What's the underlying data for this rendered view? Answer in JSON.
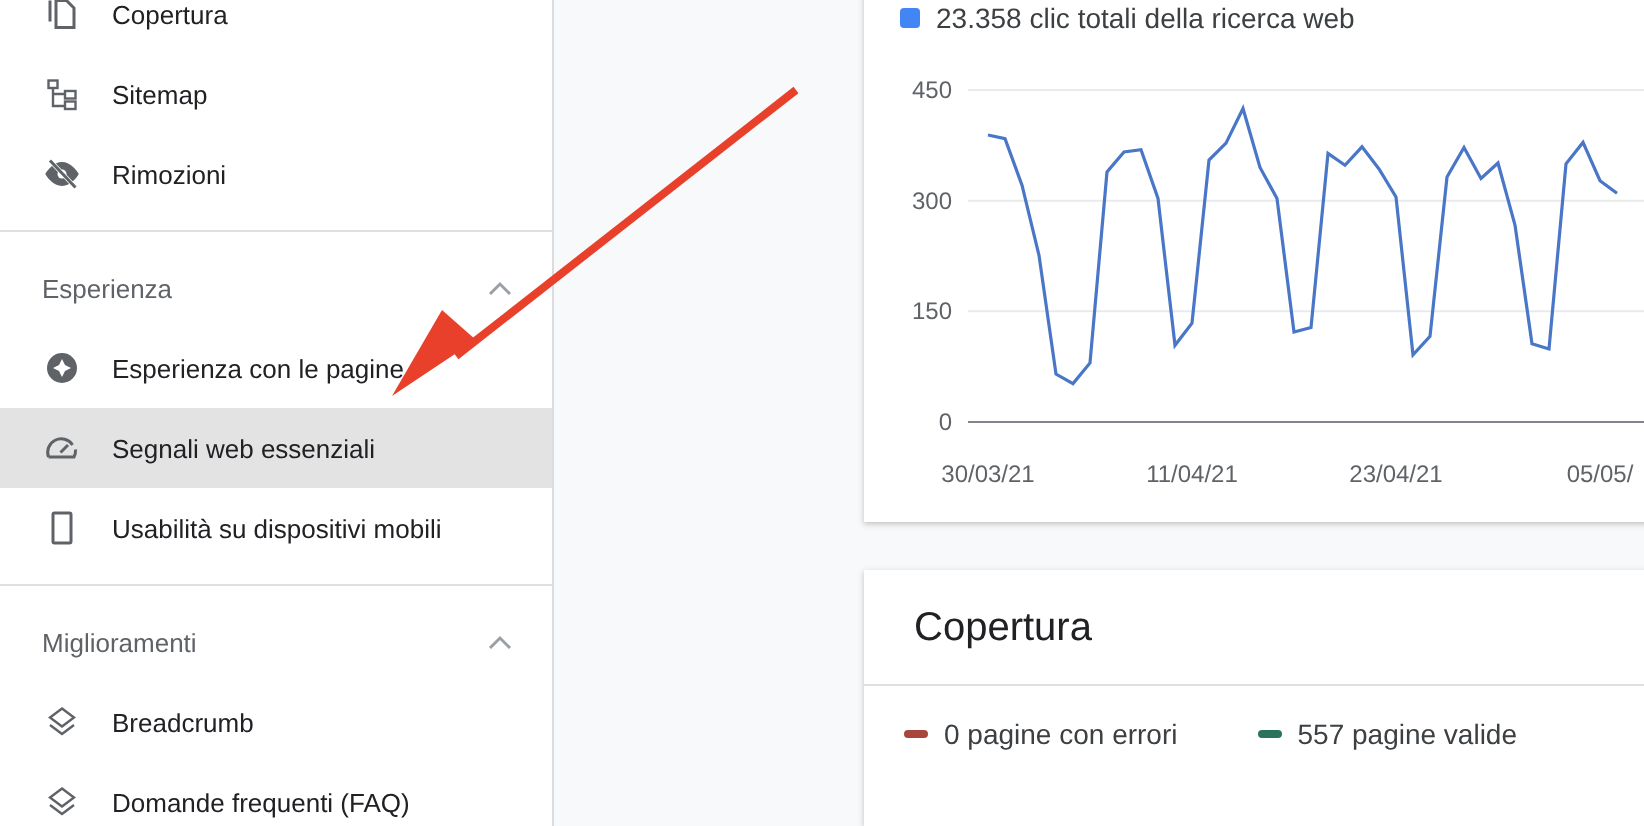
{
  "sidebar": {
    "sections": [
      {
        "items": [
          {
            "label": "Copertura",
            "selected": false
          },
          {
            "label": "Sitemap",
            "selected": false
          },
          {
            "label": "Rimozioni",
            "selected": false
          }
        ]
      },
      {
        "title": "Esperienza",
        "expanded": true,
        "items": [
          {
            "label": "Esperienza con le pagine",
            "selected": false
          },
          {
            "label": "Segnali web essenziali",
            "selected": true
          },
          {
            "label": "Usabilità su dispositivi mobili",
            "selected": false
          }
        ]
      },
      {
        "title": "Miglioramenti",
        "expanded": true,
        "items": [
          {
            "label": "Breadcrumb",
            "selected": false
          },
          {
            "label": "Domande frequenti (FAQ)",
            "selected": false
          }
        ]
      }
    ]
  },
  "performance_card": {
    "legend": [
      {
        "label": "23.358 clic totali della ricerca web",
        "color": "#4285f4"
      }
    ],
    "chart_data": {
      "type": "line",
      "categories": [
        "30/03/21",
        null,
        null,
        null,
        null,
        null,
        null,
        null,
        null,
        null,
        null,
        null,
        "11/04/21",
        null,
        null,
        null,
        null,
        null,
        null,
        null,
        null,
        null,
        null,
        null,
        "23/04/21",
        null,
        null,
        null,
        null,
        null,
        null,
        null,
        null,
        null,
        null,
        null,
        "05/05/",
        null
      ],
      "series": [
        {
          "color": "#4a76c7",
          "values": [
            389,
            384,
            321,
            226,
            65,
            52,
            80,
            339,
            366,
            369,
            303,
            104,
            134,
            355,
            378,
            425,
            345,
            303,
            122,
            128,
            364,
            348,
            373,
            343,
            305,
            91,
            116,
            332,
            372,
            330,
            351,
            267,
            106,
            99,
            350,
            379,
            327,
            310
          ]
        }
      ],
      "ylim": [
        0,
        450
      ],
      "yticks": [
        0,
        150,
        300,
        450
      ]
    }
  },
  "coverage_card": {
    "title": "Copertura",
    "legend": [
      {
        "label": "0 pagine con errori",
        "color": "#a9463b"
      },
      {
        "label": "557 pagine valide",
        "color": "#2b735a"
      }
    ]
  }
}
